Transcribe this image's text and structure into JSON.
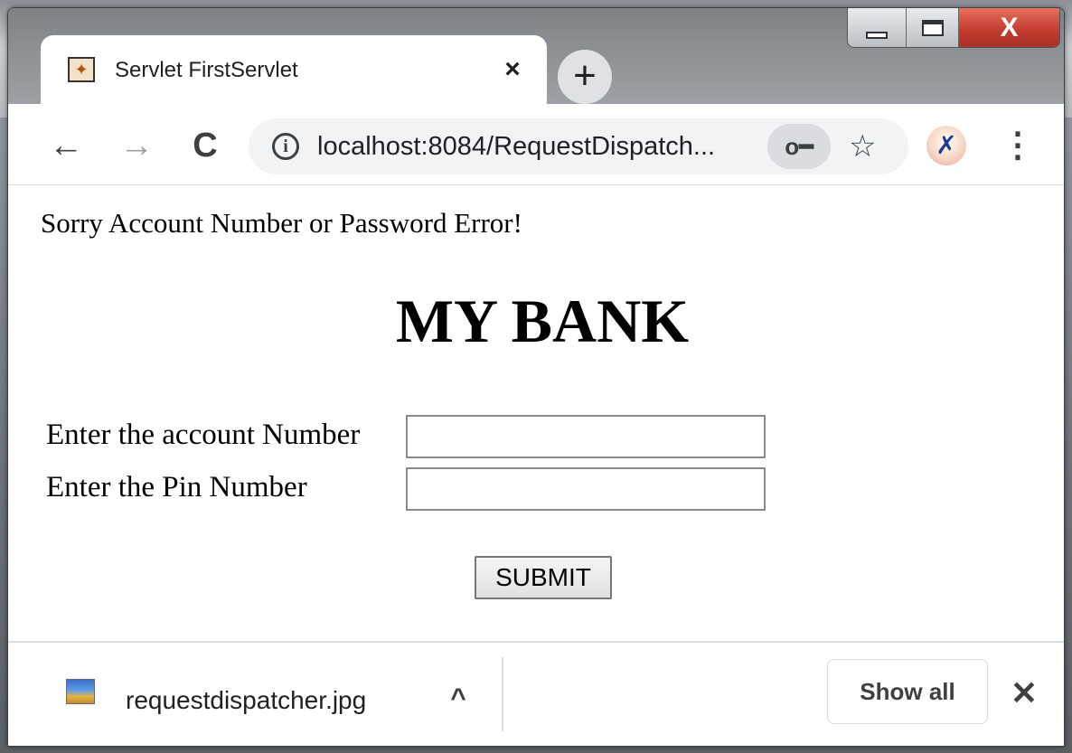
{
  "browser": {
    "tab": {
      "title": "Servlet FirstServlet",
      "close_glyph": "×",
      "favicon": "servlet-favicon-icon"
    },
    "new_tab_glyph": "+",
    "window_controls": {
      "minimize": "minimize-icon",
      "maximize": "maximize-icon",
      "close_glyph": "X"
    },
    "nav": {
      "back_glyph": "←",
      "forward_glyph": "→",
      "reload_glyph": "C"
    },
    "omnibox": {
      "info_glyph": "i",
      "url": "localhost:8084/RequestDispatch...",
      "key_glyph": "o━",
      "star_glyph": "☆"
    },
    "profile_glyph": "✗",
    "menu_glyph": "⋮"
  },
  "page": {
    "error_message": "Sorry Account Number or Password Error!",
    "title": "MY BANK",
    "form": {
      "account_label": "Enter the account Number",
      "account_value": "",
      "pin_label": "Enter the Pin Number",
      "pin_value": "",
      "submit_label": "SUBMIT"
    }
  },
  "downloads_bar": {
    "file_name": "requestdispatcher.jpg",
    "chevron_glyph": "^",
    "show_all_label": "Show all",
    "close_glyph": "✕"
  },
  "colors": {
    "close_red": "#c0392b",
    "toolbar_bg": "#ffffff",
    "omnibox_bg": "#f1f3f4",
    "titlebar_bg": "#8e9398"
  }
}
